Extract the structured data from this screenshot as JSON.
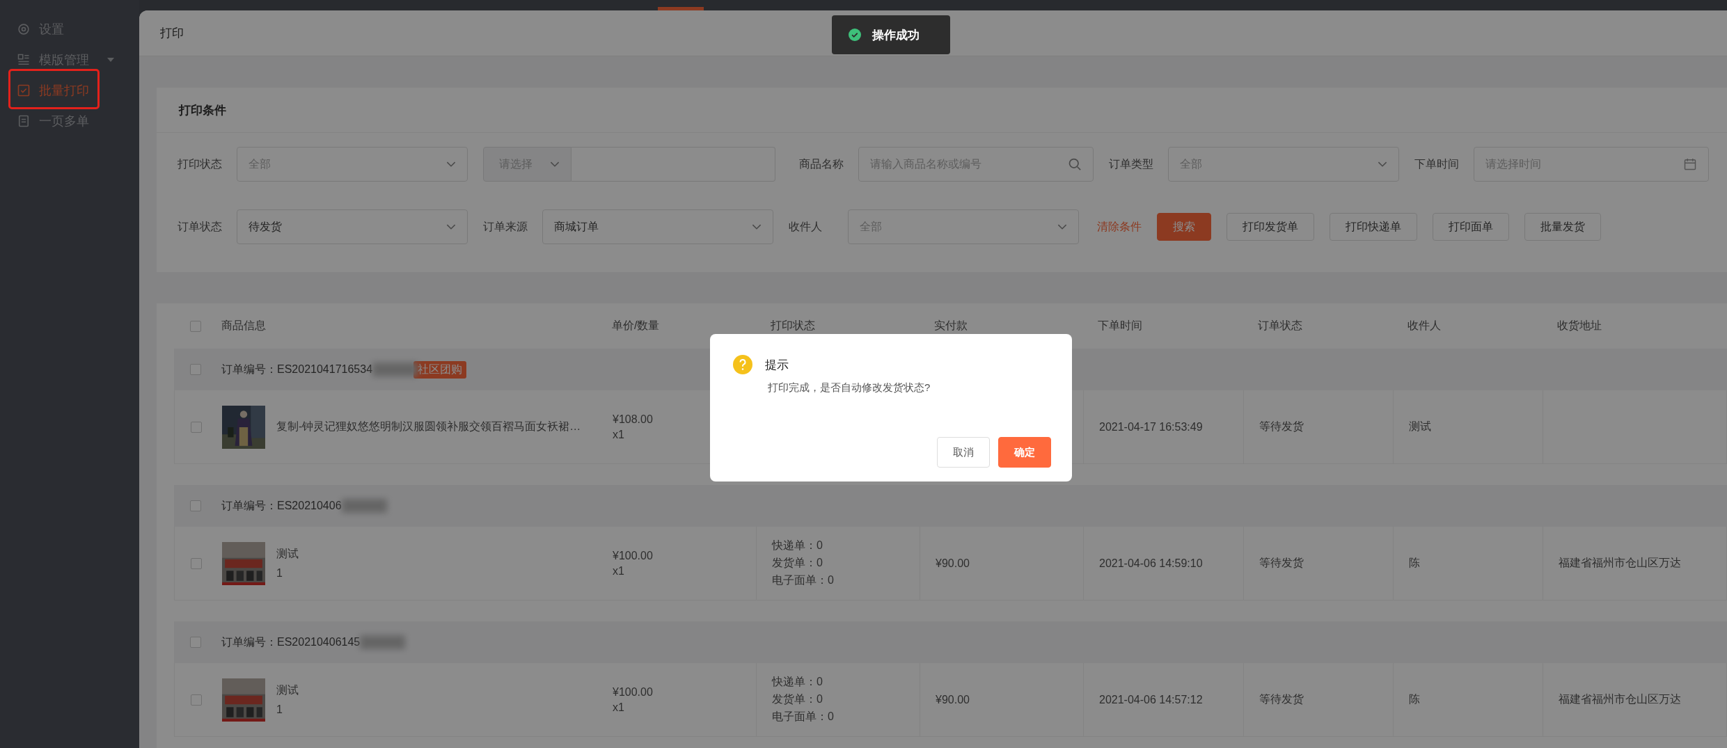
{
  "sidebar": {
    "items": [
      {
        "label": "设置",
        "selected": false,
        "has_submenu": false,
        "outlined": false
      },
      {
        "label": "模版管理",
        "selected": false,
        "has_submenu": true,
        "outlined": false
      },
      {
        "label": "批量打印",
        "selected": true,
        "has_submenu": false,
        "outlined": true
      },
      {
        "label": "一页多单",
        "selected": false,
        "has_submenu": false,
        "outlined": false
      }
    ]
  },
  "page": {
    "title": "打印"
  },
  "toast": {
    "text": "操作成功"
  },
  "filters": {
    "title": "打印条件",
    "rows": [
      [
        {
          "kind": "select",
          "label": "打印状态",
          "placeholder": "全部"
        },
        {
          "kind": "combo",
          "prefix": "请选择"
        },
        {
          "kind": "search",
          "label": "商品名称",
          "placeholder": "请输入商品名称或编号"
        },
        {
          "kind": "select",
          "label": "订单类型",
          "placeholder": "全部"
        },
        {
          "kind": "date",
          "label": "下单时间",
          "placeholder": "请选择时间"
        }
      ],
      [
        {
          "kind": "select",
          "label": "订单状态",
          "value": "待发货"
        },
        {
          "kind": "select",
          "label": "订单来源",
          "value": "商城订单"
        },
        {
          "kind": "select",
          "label": "收件人",
          "placeholder": "全部"
        }
      ]
    ],
    "actions": [
      {
        "kind": "link",
        "label": "清除条件"
      },
      {
        "kind": "primary",
        "label": "搜索"
      },
      {
        "kind": "default",
        "label": "打印发货单"
      },
      {
        "kind": "default",
        "label": "打印快递单"
      },
      {
        "kind": "default",
        "label": "打印面单"
      },
      {
        "kind": "default",
        "label": "批量发货"
      }
    ]
  },
  "table": {
    "all_checked": false,
    "columns": [
      "商品信息",
      "单价/数量",
      "打印状态",
      "实付款",
      "下单时间",
      "订单状态",
      "收件人",
      "收货地址"
    ],
    "orders": [
      {
        "checked": false,
        "number": "订单编号：ES2021041716534",
        "redacted": true,
        "tag": "社区团购",
        "item": {
          "checked": false,
          "title": "复制-钟灵记狸奴悠悠明制汉服圆领补服交领百褶马面女袄裙…",
          "price": "¥108.00",
          "quantity": "x1",
          "time": "2021-04-17 16:53:49",
          "status": "等待发货",
          "receiver": "测试"
        }
      },
      {
        "checked": false,
        "number": "订单编号：ES20210406",
        "redacted": true,
        "item": {
          "checked": false,
          "title": "测试",
          "subtitle": "1",
          "price": "¥100.00",
          "quantity": "x1",
          "print_status": [
            "快递单：0",
            "发货单：0",
            "电子面单：0"
          ],
          "paid": "¥90.00",
          "time": "2021-04-06 14:59:10",
          "status": "等待发货",
          "receiver": "陈",
          "address": "福建省福州市仓山区万达"
        }
      },
      {
        "checked": false,
        "number": "订单编号：ES20210406145",
        "redacted": true,
        "item": {
          "checked": false,
          "title": "测试",
          "subtitle": "1",
          "price": "¥100.00",
          "quantity": "x1",
          "print_status": [
            "快递单：0",
            "发货单：0",
            "电子面单：0"
          ],
          "paid": "¥90.00",
          "time": "2021-04-06 14:57:12",
          "status": "等待发货",
          "receiver": "陈",
          "address": "福建省福州市仓山区万达"
        }
      }
    ]
  },
  "dialog": {
    "title": "提示",
    "message": "打印完成，是否自动修改发货状态?",
    "buttons": [
      {
        "kind": "default",
        "label": "取消"
      },
      {
        "kind": "primary",
        "label": "确定"
      }
    ]
  }
}
